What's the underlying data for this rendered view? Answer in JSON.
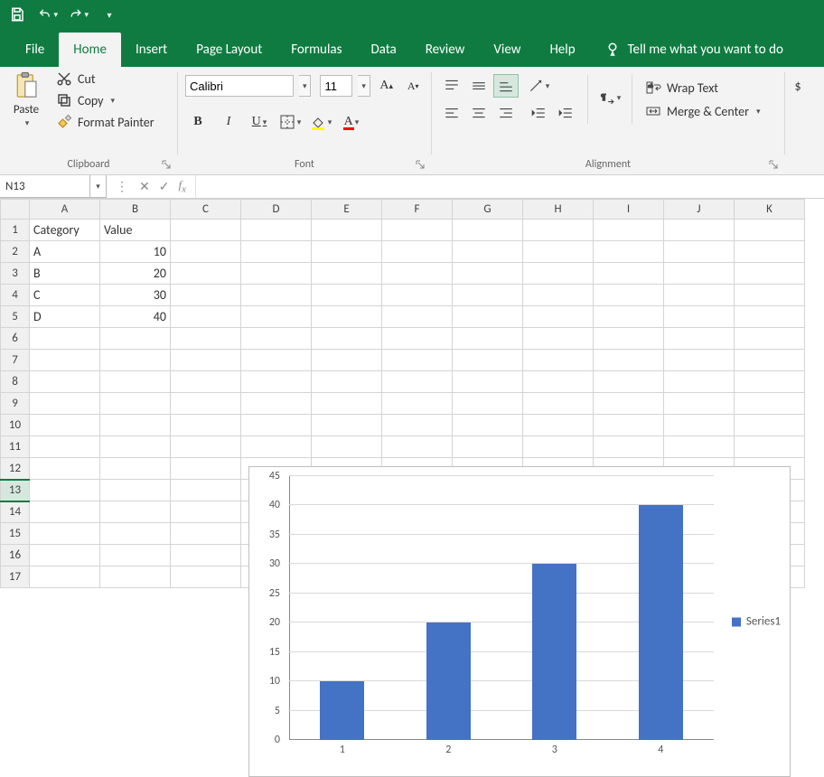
{
  "qat": {
    "save": "Save",
    "undo": "Undo",
    "redo": "Redo"
  },
  "tabs": {
    "file": "File",
    "home": "Home",
    "insert": "Insert",
    "page_layout": "Page Layout",
    "formulas": "Formulas",
    "data": "Data",
    "review": "Review",
    "view": "View",
    "help": "Help",
    "tellme": "Tell me what you want to do"
  },
  "ribbon": {
    "clipboard": {
      "title": "Clipboard",
      "paste": "Paste",
      "cut": "Cut",
      "copy": "Copy",
      "format_painter": "Format Painter"
    },
    "font": {
      "title": "Font",
      "name": "Calibri",
      "size": "11"
    },
    "alignment": {
      "title": "Alignment",
      "wrap_text": "Wrap Text",
      "merge_center": "Merge & Center"
    }
  },
  "namebox": "N13",
  "formula": "",
  "columns": [
    "A",
    "B",
    "C",
    "D",
    "E",
    "F",
    "G",
    "H",
    "I",
    "J",
    "K"
  ],
  "rows": [
    "1",
    "2",
    "3",
    "4",
    "5",
    "6",
    "7",
    "8",
    "9",
    "10",
    "11",
    "12",
    "13",
    "14",
    "15",
    "16",
    "17"
  ],
  "active_row": "13",
  "cells": {
    "headers": {
      "A": "Category",
      "B": "Value"
    },
    "data": [
      {
        "cat": "A",
        "val": "10"
      },
      {
        "cat": "B",
        "val": "20"
      },
      {
        "cat": "C",
        "val": "30"
      },
      {
        "cat": "D",
        "val": "40"
      }
    ]
  },
  "chart_data": {
    "type": "bar",
    "categories": [
      "1",
      "2",
      "3",
      "4"
    ],
    "values": [
      10,
      20,
      30,
      40
    ],
    "series_name": "Series1",
    "ylim": [
      0,
      45
    ],
    "yticks": [
      0,
      5,
      10,
      15,
      20,
      25,
      30,
      35,
      40,
      45
    ],
    "bar_color": "#4472c4"
  }
}
